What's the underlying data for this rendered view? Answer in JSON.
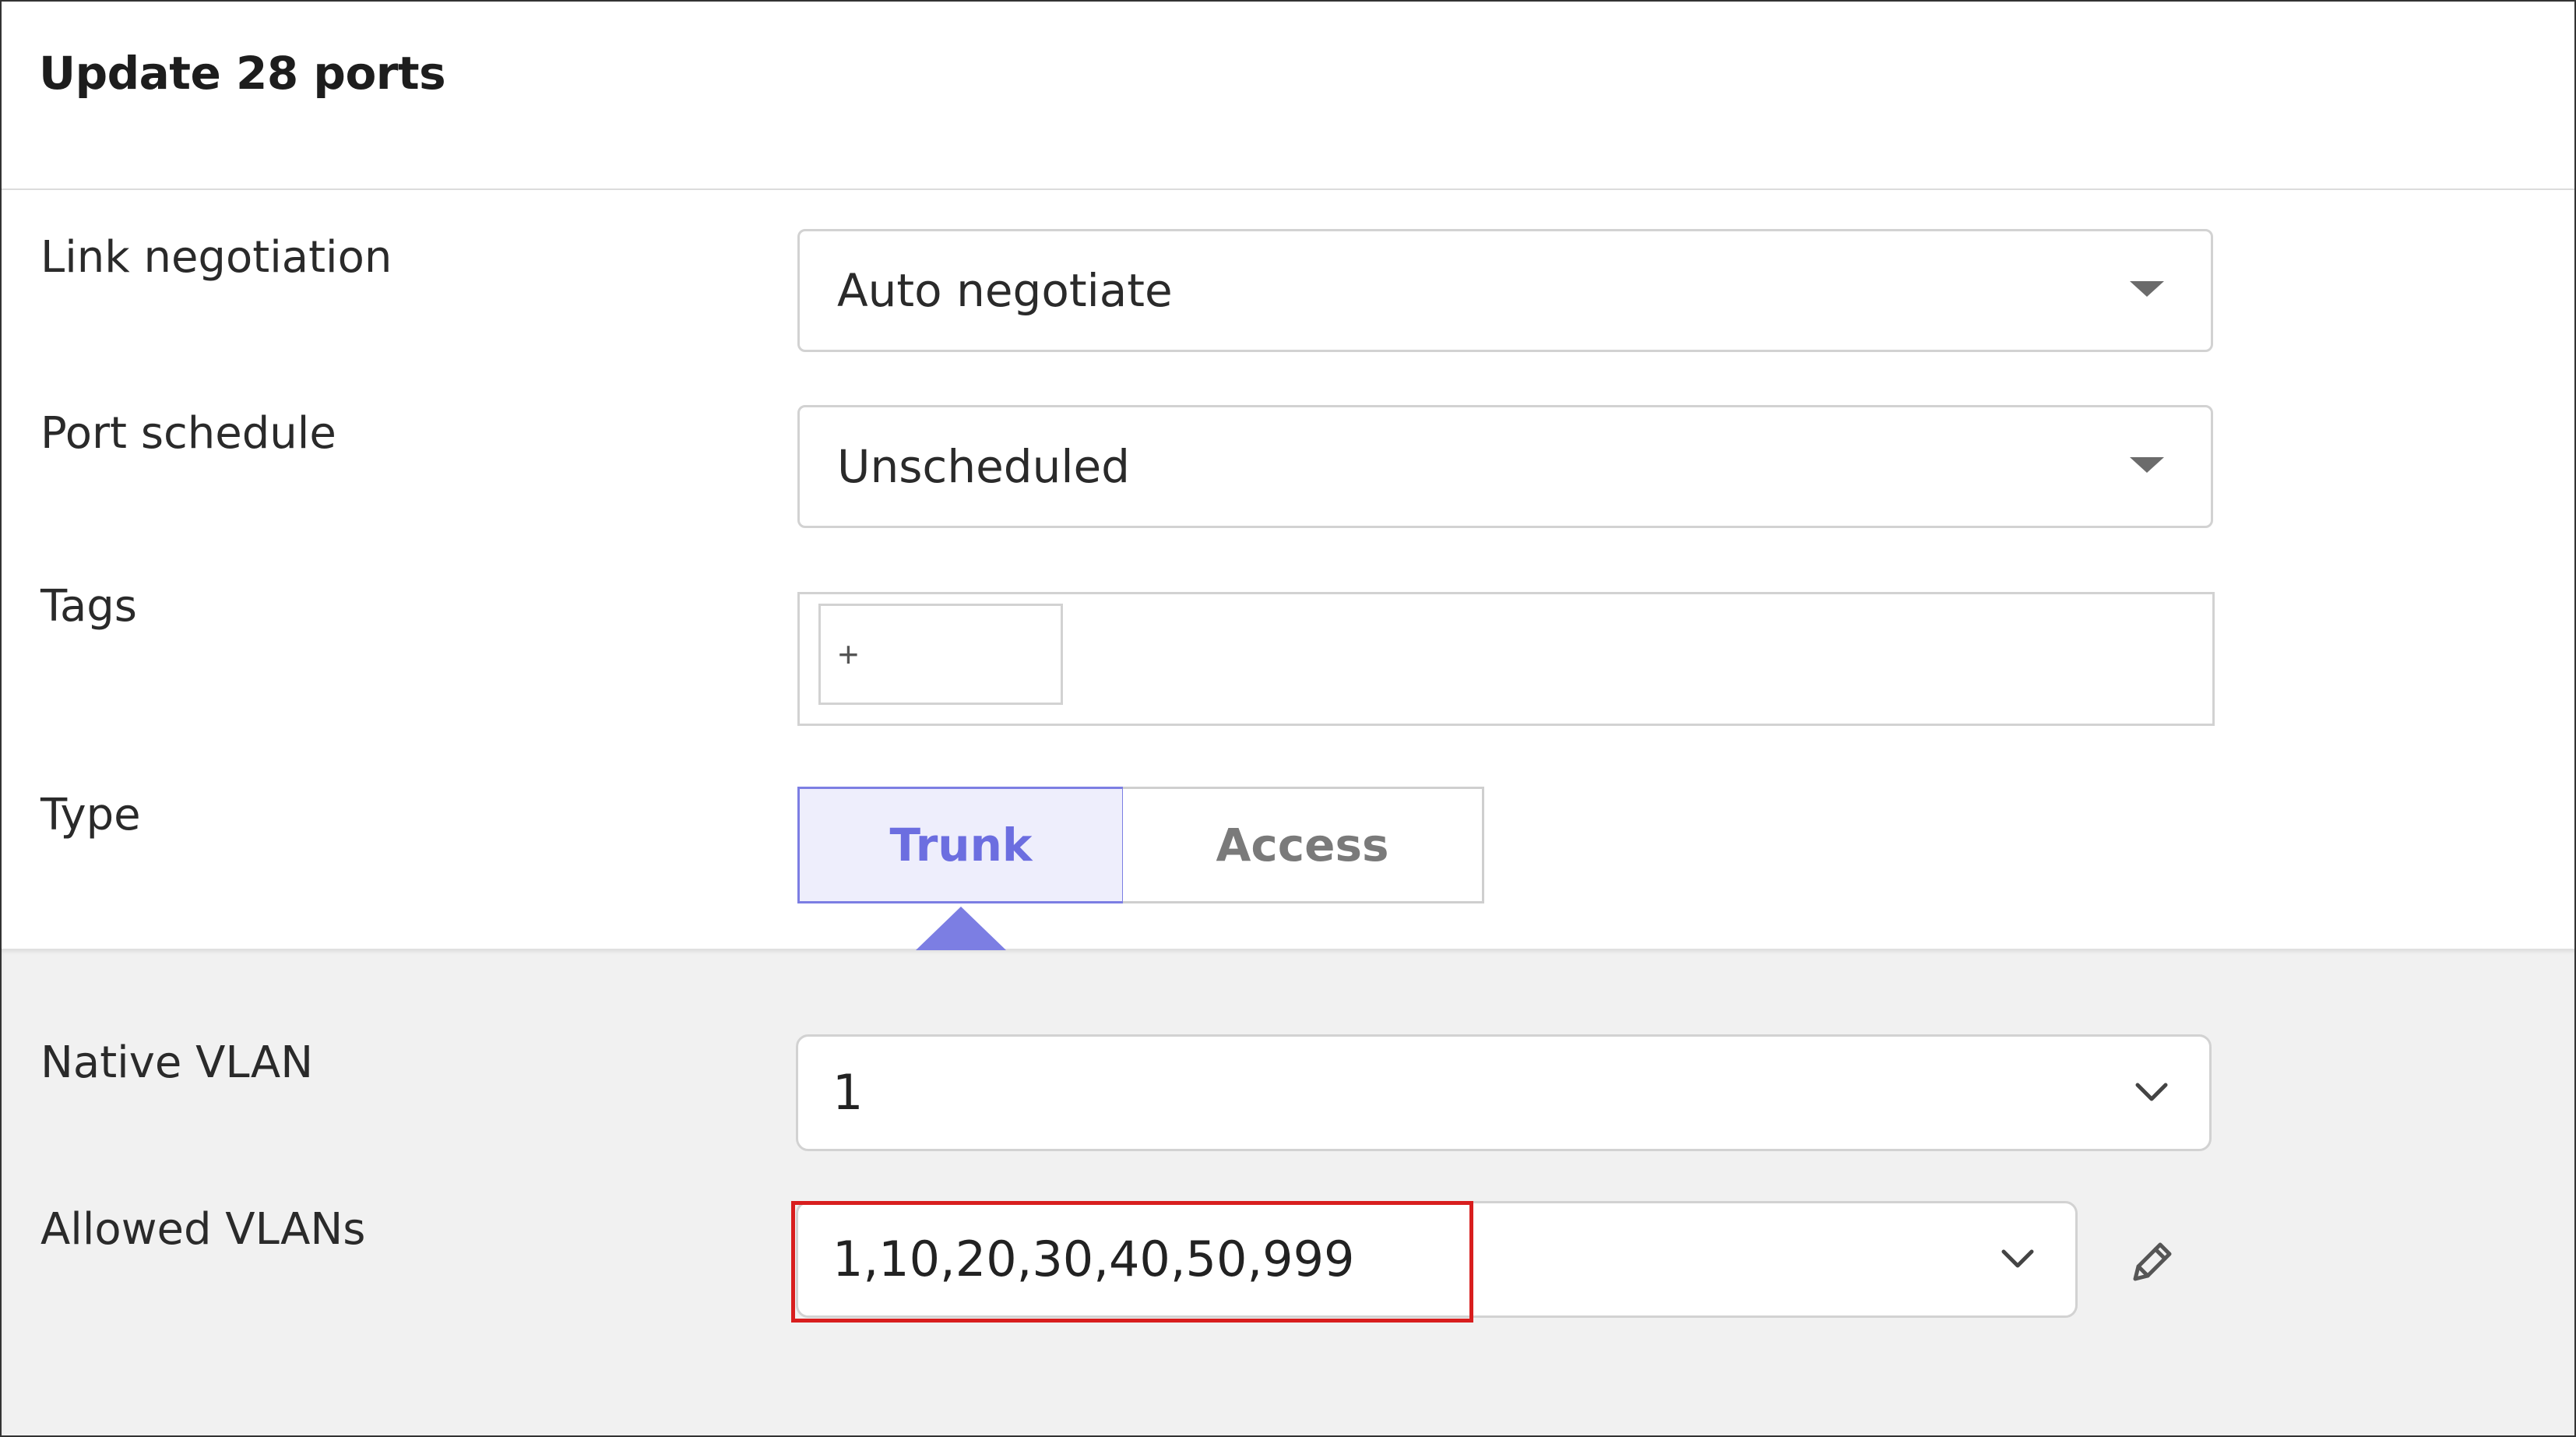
{
  "header": {
    "title": "Update 28 ports"
  },
  "fields": {
    "link_negotiation": {
      "label": "Link negotiation",
      "value": "Auto negotiate"
    },
    "port_schedule": {
      "label": "Port schedule",
      "value": "Unscheduled"
    },
    "tags": {
      "label": "Tags",
      "add_symbol": "+"
    },
    "type": {
      "label": "Type",
      "options": [
        "Trunk",
        "Access"
      ],
      "selected": "Trunk"
    }
  },
  "trunk_settings": {
    "native_vlan": {
      "label": "Native VLAN",
      "value": "1"
    },
    "allowed_vlans": {
      "label": "Allowed VLANs",
      "value": "1,10,20,30,40,50,999"
    }
  },
  "icons": {
    "dropdown_caret": "caret-down-icon",
    "dropdown_chevron": "chevron-down-icon",
    "edit": "pencil-icon"
  },
  "colors": {
    "accent": "#7c7ee3",
    "accent_text": "#6c6ee0",
    "highlight_box": "#d81e1e",
    "panel_bg": "#f1f1f1"
  }
}
